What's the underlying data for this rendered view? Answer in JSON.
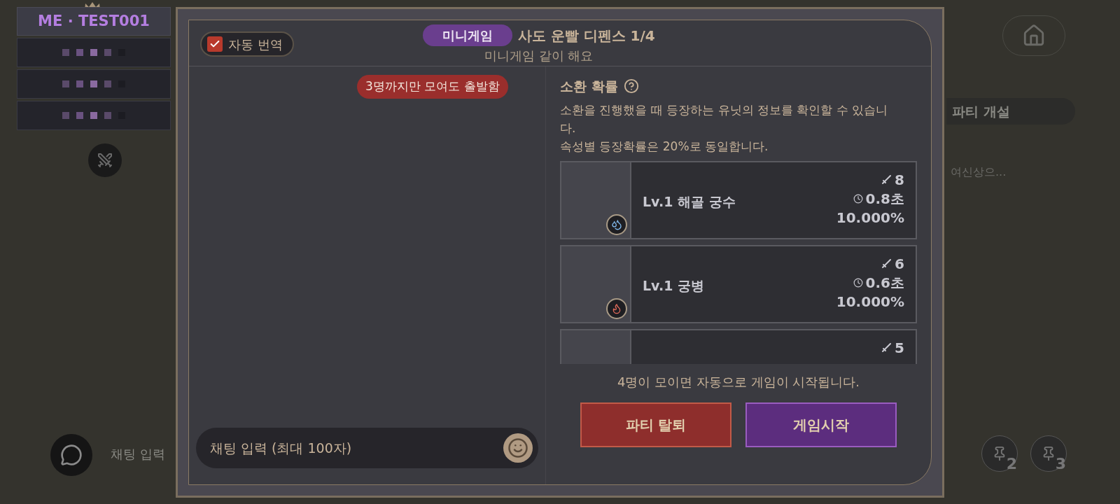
{
  "game_hud": {
    "party_leader": "ME · TEST001",
    "create_party": "파티 개설",
    "quest_text": "여신상으...",
    "chat_hint": "채팅 입력",
    "pins": [
      {
        "label": "2"
      },
      {
        "label": "3"
      }
    ]
  },
  "dialog": {
    "auto_translate": {
      "label": "자동 번역",
      "checked": true
    },
    "badge": "미니게임",
    "title": "사도 운빨 디펜스 1/4",
    "subtitle": "미니게임 같이 해요",
    "notice_bubble": "3명까지만 모여도 출발함",
    "chat_input": {
      "placeholder": "채팅 입력 (최대 100자)"
    },
    "summon_info": {
      "heading": "소환 확률",
      "description": "소환을 진행했을 때 등장하는 유닛의 정보를 확인할 수 있습니다.",
      "note": "속성별 등장확률은 20%로 동일합니다."
    },
    "units": [
      {
        "name": "Lv.1 해골 궁수",
        "attack": "8",
        "cooldown": "0.8초",
        "rate": "10.000%",
        "kind": "water"
      },
      {
        "name": "Lv.1 궁병",
        "attack": "6",
        "cooldown": "0.6초",
        "rate": "10.000%",
        "kind": "fire"
      },
      {
        "attack": "5"
      }
    ],
    "auto_start_note": "4명이 모이면 자동으로 게임이 시작됩니다.",
    "buttons": [
      {
        "kind": "leave",
        "label": "파티 탈퇴"
      },
      {
        "kind": "start",
        "label": "게임시작"
      }
    ]
  }
}
